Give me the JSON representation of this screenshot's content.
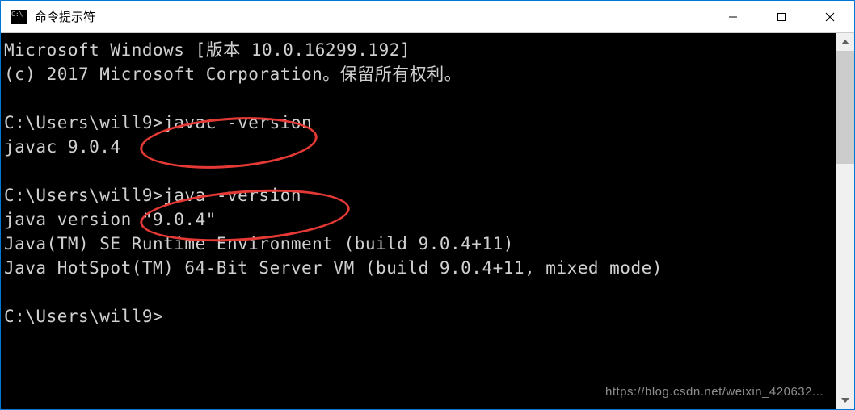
{
  "titlebar": {
    "title": "命令提示符"
  },
  "terminal": {
    "lines": {
      "l1": "Microsoft Windows [版本 10.0.16299.192]",
      "l2": "(c) 2017 Microsoft Corporation。保留所有权利。",
      "l3": "",
      "l4": "C:\\Users\\will9>javac -version",
      "l5": "javac 9.0.4",
      "l6": "",
      "l7": "C:\\Users\\will9>java -version",
      "l8": "java version \"9.0.4\"",
      "l9": "Java(TM) SE Runtime Environment (build 9.0.4+11)",
      "l10": "Java HotSpot(TM) 64-Bit Server VM (build 9.0.4+11, mixed mode)",
      "l11": "",
      "l12": "C:\\Users\\will9>"
    }
  },
  "annotations": {
    "ellipse1_target": "javac -version",
    "ellipse2_target": "java -version",
    "color": "#e53935"
  },
  "watermark": {
    "text": "https://blog.csdn.net/weixin_420632..."
  }
}
